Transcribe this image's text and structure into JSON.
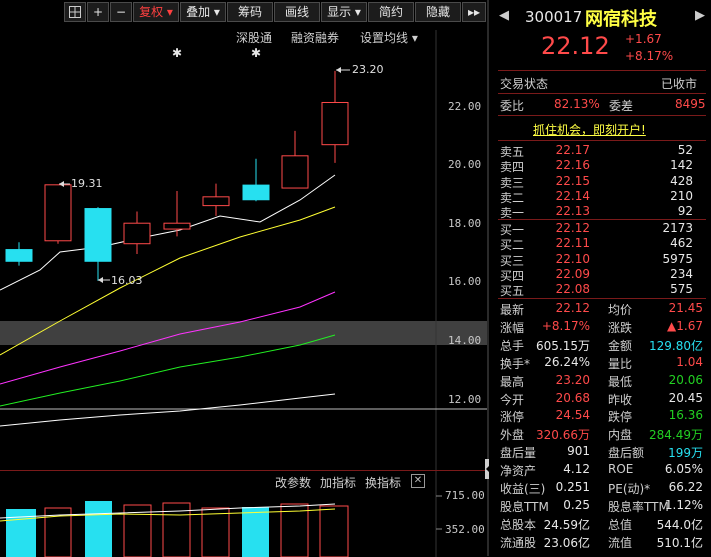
{
  "toolbar": {
    "buttons": [
      "复权",
      "叠加",
      "筹码",
      "画线",
      "显示",
      "简约",
      "隐藏"
    ],
    "icons": [
      "grid-icon",
      "plus-icon",
      "minus-icon",
      "double-chevron-right-icon"
    ]
  },
  "chart_links": [
    "深股通",
    "融资融券",
    "设置均线"
  ],
  "price_axis": [
    "22.00",
    "20.00",
    "18.00",
    "16.00",
    "14.00",
    "12.00"
  ],
  "annotations": {
    "high": "23.20",
    "mid_high": "19.31",
    "low": "16.03"
  },
  "volume_toolbar": [
    "改参数",
    "加指标",
    "换指标"
  ],
  "volume_axis": [
    "715.00",
    "352.00"
  ],
  "stock": {
    "code": "300017",
    "name": "网宿科技",
    "price": "22.12",
    "change": "+1.67",
    "change_pct": "+8.17%"
  },
  "trade_status": {
    "label": "交易状态",
    "value": "已收市"
  },
  "ratio": {
    "label1": "委比",
    "value1": "82.13%",
    "label2": "委差",
    "value2": "8495"
  },
  "banner": "抓住机会，即刻开户!",
  "sell_orders": [
    {
      "label": "卖五",
      "price": "22.17",
      "volume": "52"
    },
    {
      "label": "卖四",
      "price": "22.16",
      "volume": "142"
    },
    {
      "label": "卖三",
      "price": "22.15",
      "volume": "428"
    },
    {
      "label": "卖二",
      "price": "22.14",
      "volume": "210"
    },
    {
      "label": "卖一",
      "price": "22.13",
      "volume": "92"
    }
  ],
  "buy_orders": [
    {
      "label": "买一",
      "price": "22.12",
      "volume": "2173"
    },
    {
      "label": "买二",
      "price": "22.11",
      "volume": "462"
    },
    {
      "label": "买三",
      "price": "22.10",
      "volume": "5975"
    },
    {
      "label": "买四",
      "price": "22.09",
      "volume": "234"
    },
    {
      "label": "买五",
      "price": "22.08",
      "volume": "575"
    }
  ],
  "quote_pairs": [
    {
      "l1": "最新",
      "v1": "22.12",
      "c1": "up",
      "l2": "均价",
      "v2": "21.45",
      "c2": "up"
    },
    {
      "l1": "涨幅",
      "v1": "+8.17%",
      "c1": "up",
      "l2": "涨跌",
      "v2": "▲1.67",
      "c2": "up"
    },
    {
      "l1": "总手",
      "v1": "605.15万",
      "c1": "wh",
      "l2": "金额",
      "v2": "129.80亿",
      "c2": "cy"
    },
    {
      "l1": "换手*",
      "v1": "26.24%",
      "c1": "wh",
      "l2": "量比",
      "v2": "1.04",
      "c2": "up"
    },
    {
      "l1": "最高",
      "v1": "23.20",
      "c1": "up",
      "l2": "最低",
      "v2": "20.06",
      "c2": "dn"
    },
    {
      "l1": "今开",
      "v1": "20.68",
      "c1": "up",
      "l2": "昨收",
      "v2": "20.45",
      "c2": "wh"
    },
    {
      "l1": "涨停",
      "v1": "24.54",
      "c1": "up",
      "l2": "跌停",
      "v2": "16.36",
      "c2": "dn"
    },
    {
      "l1": "外盘",
      "v1": "320.66万",
      "c1": "up",
      "l2": "内盘",
      "v2": "284.49万",
      "c2": "dn"
    },
    {
      "l1": "盘后量",
      "v1": "901",
      "c1": "wh",
      "l2": "盘后额",
      "v2": "199万",
      "c2": "cy"
    },
    {
      "l1": "净资产",
      "v1": "4.12",
      "c1": "wh",
      "l2": "ROE",
      "v2": "6.05%",
      "c2": "wh"
    },
    {
      "l1": "收益(三)",
      "v1": "0.251",
      "c1": "wh",
      "l2": "PE(动)*",
      "v2": "66.22",
      "c2": "wh"
    },
    {
      "l1": "股息TTM",
      "v1": "0.25",
      "c1": "wh",
      "l2": "股息率TTM",
      "v2": "1.12%",
      "c2": "wh"
    },
    {
      "l1": "总股本",
      "v1": "24.59亿",
      "c1": "wh",
      "l2": "总值",
      "v2": "544.0亿",
      "c2": "wh"
    },
    {
      "l1": "流通股",
      "v1": "23.06亿",
      "c1": "wh",
      "l2": "流值",
      "v2": "510.1亿",
      "c2": "wh"
    }
  ],
  "colors": {
    "up": "#ff4a4a",
    "down": "#22d022",
    "cyan": "#27e0f0",
    "ma5": "#ffffff",
    "ma10": "#ffff33",
    "ma20": "#ff33ff",
    "ma60": "#22ee22"
  },
  "candles": [
    {
      "o": 16.7,
      "c": 17.1,
      "h": 17.35,
      "l": 16.55,
      "dir": "down"
    },
    {
      "o": 17.4,
      "c": 19.31,
      "h": 19.31,
      "l": 17.3,
      "dir": "up"
    },
    {
      "o": 18.5,
      "c": 16.7,
      "h": 18.55,
      "l": 16.03,
      "dir": "down"
    },
    {
      "o": 17.3,
      "c": 18.0,
      "h": 18.4,
      "l": 16.95,
      "dir": "up"
    },
    {
      "o": 17.8,
      "c": 18.0,
      "h": 19.1,
      "l": 17.55,
      "dir": "up"
    },
    {
      "o": 18.6,
      "c": 18.9,
      "h": 19.35,
      "l": 18.25,
      "dir": "up"
    },
    {
      "o": 19.3,
      "c": 18.8,
      "h": 20.2,
      "l": 18.75,
      "dir": "down"
    },
    {
      "o": 19.2,
      "c": 20.3,
      "h": 21.15,
      "l": 19.2,
      "dir": "up"
    },
    {
      "o": 20.68,
      "c": 22.12,
      "h": 23.2,
      "l": 20.06,
      "dir": "up"
    }
  ]
}
